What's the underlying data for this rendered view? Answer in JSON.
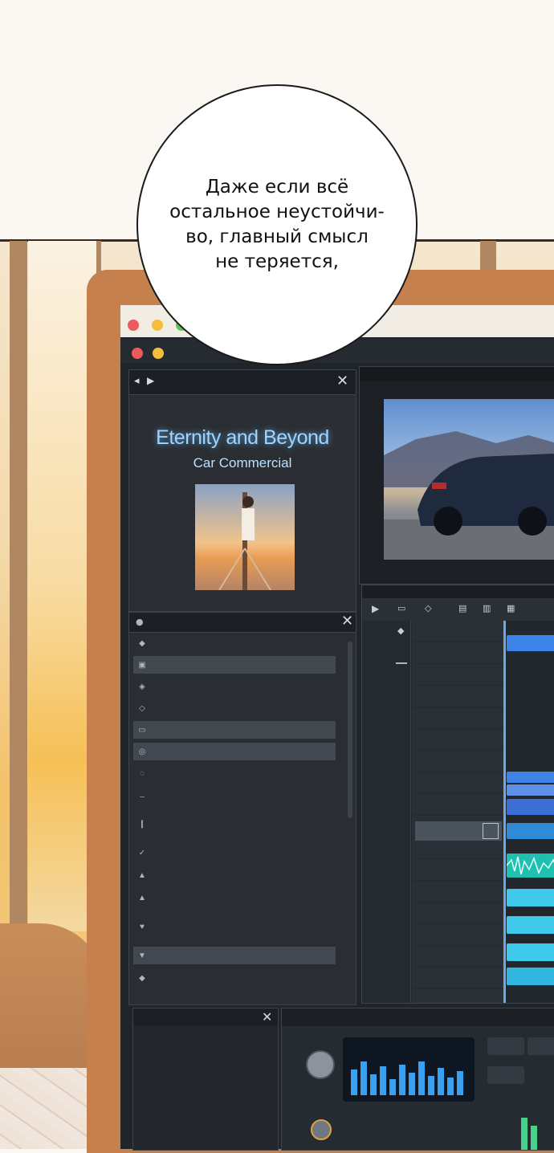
{
  "speech_bubble": {
    "lines": [
      "Даже если всё",
      "остальное неустойчи-",
      "во, главный смысл",
      "не теряется,"
    ]
  },
  "project_panel": {
    "title": "Eternity and Beyond",
    "subtitle": "Car Commercial",
    "accent_color": "#9fd4ff"
  },
  "colors": {
    "close_dot": "#ec5b5b",
    "minimize_dot": "#f2be3c",
    "zoom_dot": "#5fc75a",
    "clip_blue": "#3d83e8",
    "clip_cyan": "#3ec9ea"
  }
}
